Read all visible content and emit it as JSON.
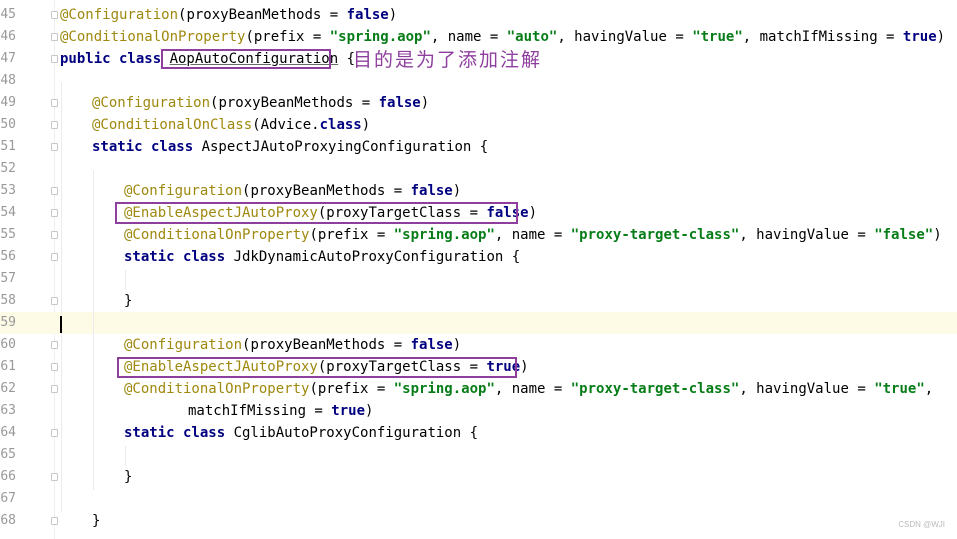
{
  "lines": [
    {
      "number": "45",
      "tokens": [
        {
          "t": "@Configuration",
          "c": "ann"
        },
        {
          "t": "(proxyBeanMethods = "
        },
        {
          "t": "false",
          "c": "kw"
        },
        {
          "t": ")"
        }
      ]
    },
    {
      "number": "46",
      "tokens": [
        {
          "t": "@ConditionalOnProperty",
          "c": "ann"
        },
        {
          "t": "(prefix = "
        },
        {
          "t": "\"spring.aop\"",
          "c": "str"
        },
        {
          "t": ", name = "
        },
        {
          "t": "\"auto\"",
          "c": "str"
        },
        {
          "t": ", havingValue = "
        },
        {
          "t": "\"true\"",
          "c": "str"
        },
        {
          "t": ", matchIfMissing = "
        },
        {
          "t": "true",
          "c": "kw"
        },
        {
          "t": ")"
        }
      ]
    },
    {
      "number": "47",
      "tokens": [
        {
          "t": "public class ",
          "c": "kw"
        },
        {
          "t": "AopAutoConfiguration",
          "c": "ul"
        },
        {
          "t": " {"
        }
      ]
    },
    {
      "number": "48",
      "tokens": []
    },
    {
      "number": "49",
      "tokens": [
        {
          "t": "@Configuration",
          "c": "ann"
        },
        {
          "t": "(proxyBeanMethods = "
        },
        {
          "t": "false",
          "c": "kw"
        },
        {
          "t": ")"
        }
      ]
    },
    {
      "number": "50",
      "tokens": [
        {
          "t": "@ConditionalOnClass",
          "c": "ann"
        },
        {
          "t": "(Advice."
        },
        {
          "t": "class",
          "c": "kw"
        },
        {
          "t": ")"
        }
      ]
    },
    {
      "number": "51",
      "tokens": [
        {
          "t": "static class ",
          "c": "kw"
        },
        {
          "t": "AspectJAutoProxyingConfiguration {"
        }
      ]
    },
    {
      "number": "52",
      "tokens": []
    },
    {
      "number": "53",
      "tokens": [
        {
          "t": "@Configuration",
          "c": "ann"
        },
        {
          "t": "(proxyBeanMethods = "
        },
        {
          "t": "false",
          "c": "kw"
        },
        {
          "t": ")"
        }
      ]
    },
    {
      "number": "54",
      "tokens": [
        {
          "t": "@EnableAspectJAutoProxy",
          "c": "ann"
        },
        {
          "t": "(proxyTargetClass = "
        },
        {
          "t": "false",
          "c": "kw"
        },
        {
          "t": ")"
        }
      ]
    },
    {
      "number": "55",
      "tokens": [
        {
          "t": "@ConditionalOnProperty",
          "c": "ann"
        },
        {
          "t": "(prefix = "
        },
        {
          "t": "\"spring.aop\"",
          "c": "str"
        },
        {
          "t": ", name = "
        },
        {
          "t": "\"proxy-target-class\"",
          "c": "str"
        },
        {
          "t": ", havingValue = "
        },
        {
          "t": "\"false\"",
          "c": "str"
        },
        {
          "t": ")"
        }
      ]
    },
    {
      "number": "56",
      "tokens": [
        {
          "t": "static class ",
          "c": "kw"
        },
        {
          "t": "JdkDynamicAutoProxyConfiguration {"
        }
      ]
    },
    {
      "number": "57",
      "tokens": []
    },
    {
      "number": "58",
      "tokens": [
        {
          "t": "}"
        }
      ]
    },
    {
      "number": "59",
      "tokens": []
    },
    {
      "number": "60",
      "tokens": [
        {
          "t": "@Configuration",
          "c": "ann"
        },
        {
          "t": "(proxyBeanMethods = "
        },
        {
          "t": "false",
          "c": "kw"
        },
        {
          "t": ")"
        }
      ]
    },
    {
      "number": "61",
      "tokens": [
        {
          "t": "@EnableAspectJAutoProxy",
          "c": "ann"
        },
        {
          "t": "(proxyTargetClass = "
        },
        {
          "t": "true",
          "c": "kw"
        },
        {
          "t": ")"
        }
      ]
    },
    {
      "number": "62",
      "tokens": [
        {
          "t": "@ConditionalOnProperty",
          "c": "ann"
        },
        {
          "t": "(prefix = "
        },
        {
          "t": "\"spring.aop\"",
          "c": "str"
        },
        {
          "t": ", name = "
        },
        {
          "t": "\"proxy-target-class\"",
          "c": "str"
        },
        {
          "t": ", havingValue = "
        },
        {
          "t": "\"true\"",
          "c": "str"
        },
        {
          "t": ","
        }
      ]
    },
    {
      "number": "63",
      "tokens": [
        {
          "t": "matchIfMissing = "
        },
        {
          "t": "true",
          "c": "kw"
        },
        {
          "t": ")"
        }
      ]
    },
    {
      "number": "64",
      "tokens": [
        {
          "t": "static class ",
          "c": "kw"
        },
        {
          "t": "CglibAutoProxyConfiguration {"
        }
      ]
    },
    {
      "number": "65",
      "tokens": []
    },
    {
      "number": "66",
      "tokens": [
        {
          "t": "}"
        }
      ]
    },
    {
      "number": "67",
      "tokens": []
    },
    {
      "number": "68",
      "tokens": [
        {
          "t": "}"
        }
      ]
    }
  ],
  "annotation_note": "目的是为了添加注解",
  "watermark": "CSDN @WJI",
  "colors": {
    "annotation": "#9e880d",
    "keyword": "#000080",
    "string": "#067d17",
    "highlight_box": "#8e3f9e",
    "current_line": "#fdfae6"
  }
}
